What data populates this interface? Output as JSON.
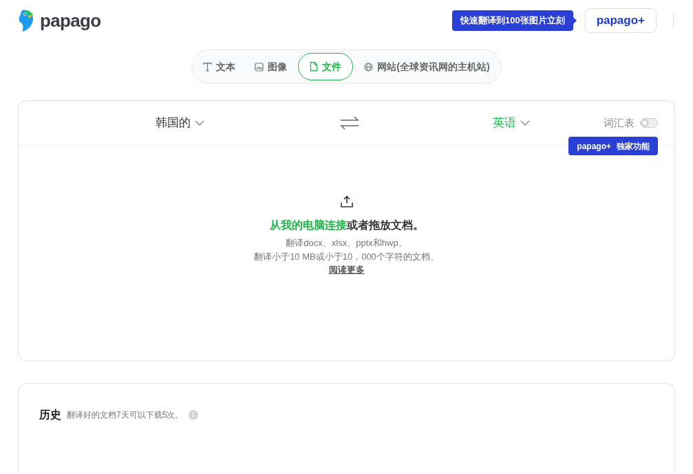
{
  "header": {
    "logo": "papago",
    "promo_tooltip": "快速翻译到100张图片立刻",
    "plus_button": "papago+"
  },
  "tabs": [
    {
      "kind": "text",
      "label": "文本",
      "selected": false
    },
    {
      "kind": "image",
      "label": "图像",
      "selected": false
    },
    {
      "kind": "file",
      "label": "文件",
      "selected": true
    },
    {
      "kind": "web",
      "label": "网站(全球资讯网的主机站)",
      "selected": false
    }
  ],
  "translator": {
    "source_language": "韩国的",
    "target_language": "英语",
    "glossary": {
      "label": "词汇表",
      "on": false
    },
    "exclusive_badge": {
      "brand": "papago+",
      "label": "独家功能"
    },
    "upload": {
      "link": "从我的电脑连接",
      "prompt": "或者拖放文档。",
      "formats": "翻译docx、xlsx、pptx和hwp。",
      "limits": "翻译小于10 MB或小于10，000个字符的文档。",
      "read_more": "阅读更多"
    }
  },
  "history": {
    "title": "历史",
    "note": "翻译好的文档7天可以下载5次。"
  }
}
